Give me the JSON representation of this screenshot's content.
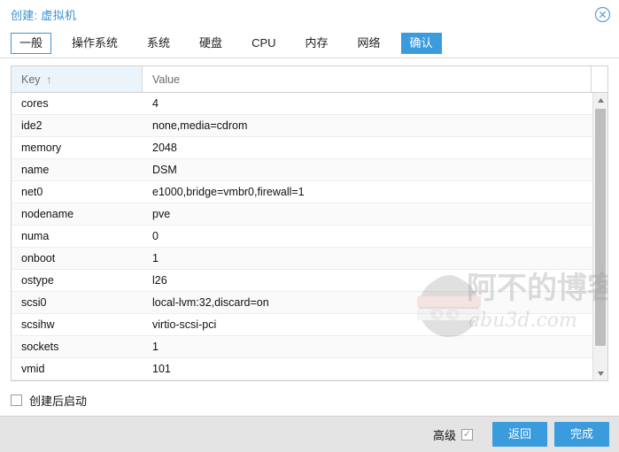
{
  "window": {
    "title": "创建: 虚拟机",
    "close_icon": "close-circle-icon"
  },
  "tabs": [
    {
      "label": "一般",
      "state": "focused"
    },
    {
      "label": "操作系统",
      "state": "normal"
    },
    {
      "label": "系统",
      "state": "normal"
    },
    {
      "label": "硬盘",
      "state": "normal"
    },
    {
      "label": "CPU",
      "state": "normal"
    },
    {
      "label": "内存",
      "state": "normal"
    },
    {
      "label": "网络",
      "state": "normal"
    },
    {
      "label": "确认",
      "state": "active"
    }
  ],
  "grid": {
    "columns": [
      {
        "label": "Key",
        "sorted": true,
        "sort_arrow": "↑"
      },
      {
        "label": "Value",
        "sorted": false,
        "sort_arrow": ""
      }
    ],
    "rows": [
      {
        "key": "cores",
        "value": "4"
      },
      {
        "key": "ide2",
        "value": "none,media=cdrom"
      },
      {
        "key": "memory",
        "value": "2048"
      },
      {
        "key": "name",
        "value": "DSM"
      },
      {
        "key": "net0",
        "value": "e1000,bridge=vmbr0,firewall=1"
      },
      {
        "key": "nodename",
        "value": "pve"
      },
      {
        "key": "numa",
        "value": "0"
      },
      {
        "key": "onboot",
        "value": "1"
      },
      {
        "key": "ostype",
        "value": "l26"
      },
      {
        "key": "scsi0",
        "value": "local-lvm:32,discard=on"
      },
      {
        "key": "scsihw",
        "value": "virtio-scsi-pci"
      },
      {
        "key": "sockets",
        "value": "1"
      },
      {
        "key": "vmid",
        "value": "101"
      }
    ],
    "scrollbar": {
      "up_icon": "triangle-up-icon",
      "down_icon": "triangle-down-icon"
    }
  },
  "options": {
    "start_after_create": {
      "label": "创建后启动",
      "checked": false,
      "tick": ""
    }
  },
  "footer": {
    "advanced": {
      "label": "高级",
      "checked": true,
      "tick": "✓"
    },
    "back_button": "返回",
    "finish_button": "完成"
  },
  "watermark": {
    "text_cn": "阿不的博客",
    "text_en": "abu3d.com"
  },
  "colors": {
    "accent": "#3b9cdd",
    "title": "#3892d4",
    "sorted_header_bg": "#ecf4fb",
    "footer_bg": "#e4e4e4"
  }
}
